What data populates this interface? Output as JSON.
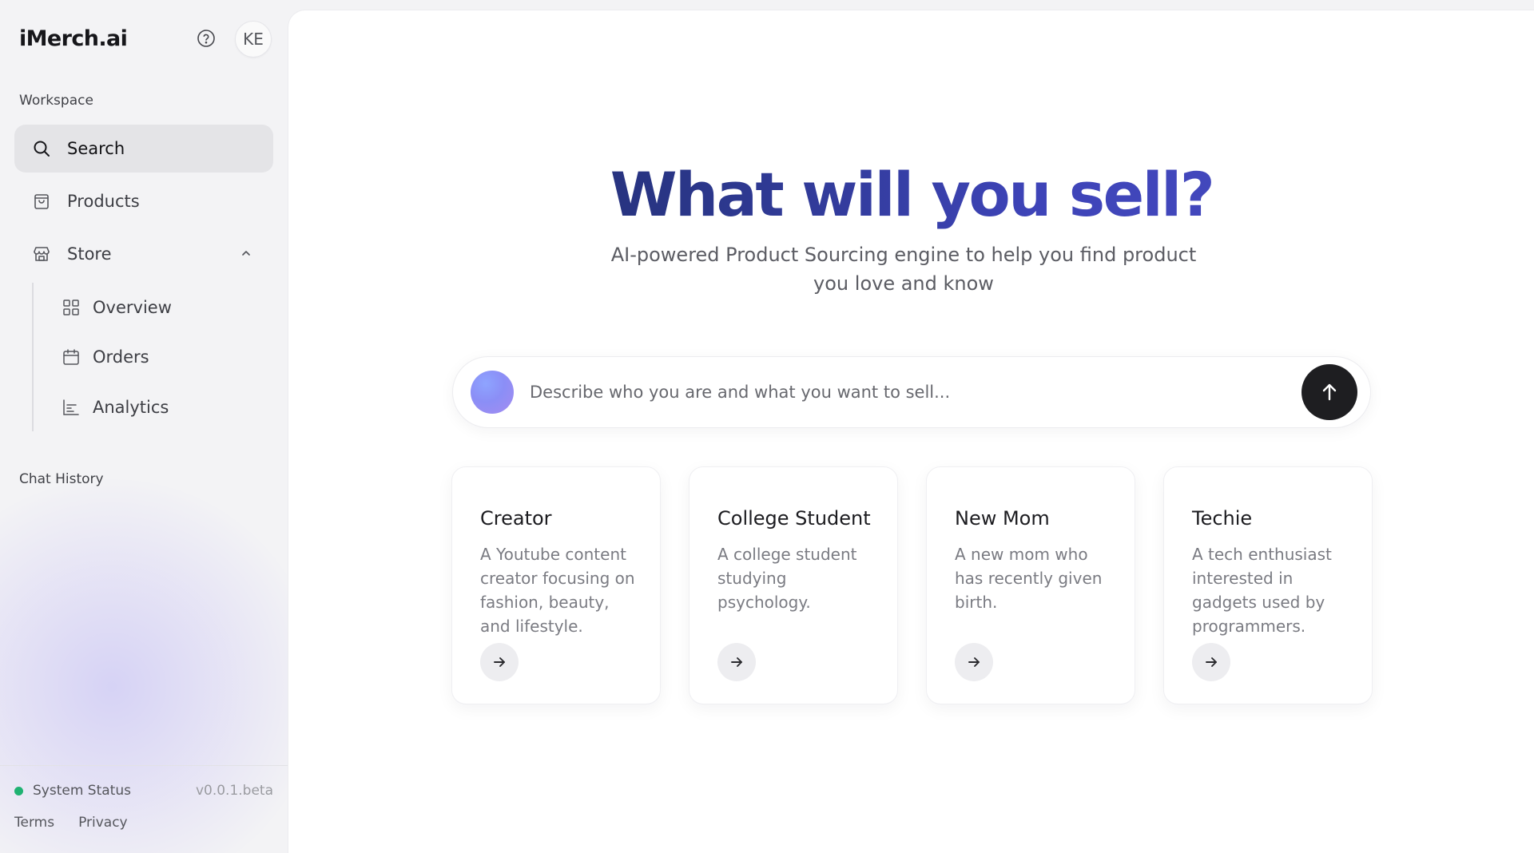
{
  "app": {
    "brand": "iMerch.ai",
    "avatar_initials": "KE"
  },
  "sidebar": {
    "workspace_label": "Workspace",
    "items": [
      {
        "label": "Search",
        "icon": "search-icon",
        "active": true
      },
      {
        "label": "Products",
        "icon": "shopping-bag-icon",
        "active": false
      },
      {
        "label": "Store",
        "icon": "store-icon",
        "active": false,
        "expanded": true
      }
    ],
    "store_subitems": [
      {
        "label": "Overview",
        "icon": "grid-icon"
      },
      {
        "label": "Orders",
        "icon": "calendar-box-icon"
      },
      {
        "label": "Analytics",
        "icon": "bar-chart-icon"
      }
    ],
    "chat_history_label": "Chat History",
    "status_label": "System Status",
    "version": "v0.0.1.beta",
    "terms_label": "Terms",
    "privacy_label": "Privacy"
  },
  "main": {
    "title": "What will you sell?",
    "subtitle": "AI-powered Product Sourcing engine to help you find product you love and know",
    "prompt_placeholder": "Describe who you are and what you want to sell...",
    "cards": [
      {
        "title": "Creator",
        "description": "A Youtube content creator focusing on fashion, beauty, and lifestyle."
      },
      {
        "title": "College Student",
        "description": "A college student studying psychology."
      },
      {
        "title": "New Mom",
        "description": "A new mom who has recently given birth."
      },
      {
        "title": "Techie",
        "description": "A tech enthusiast interested in gadgets used by programmers."
      }
    ]
  },
  "colors": {
    "accent_dark": "#1f2a62",
    "accent_light": "#4a4ec4",
    "status_green": "#1fb272",
    "send_button": "#1e1e21"
  }
}
